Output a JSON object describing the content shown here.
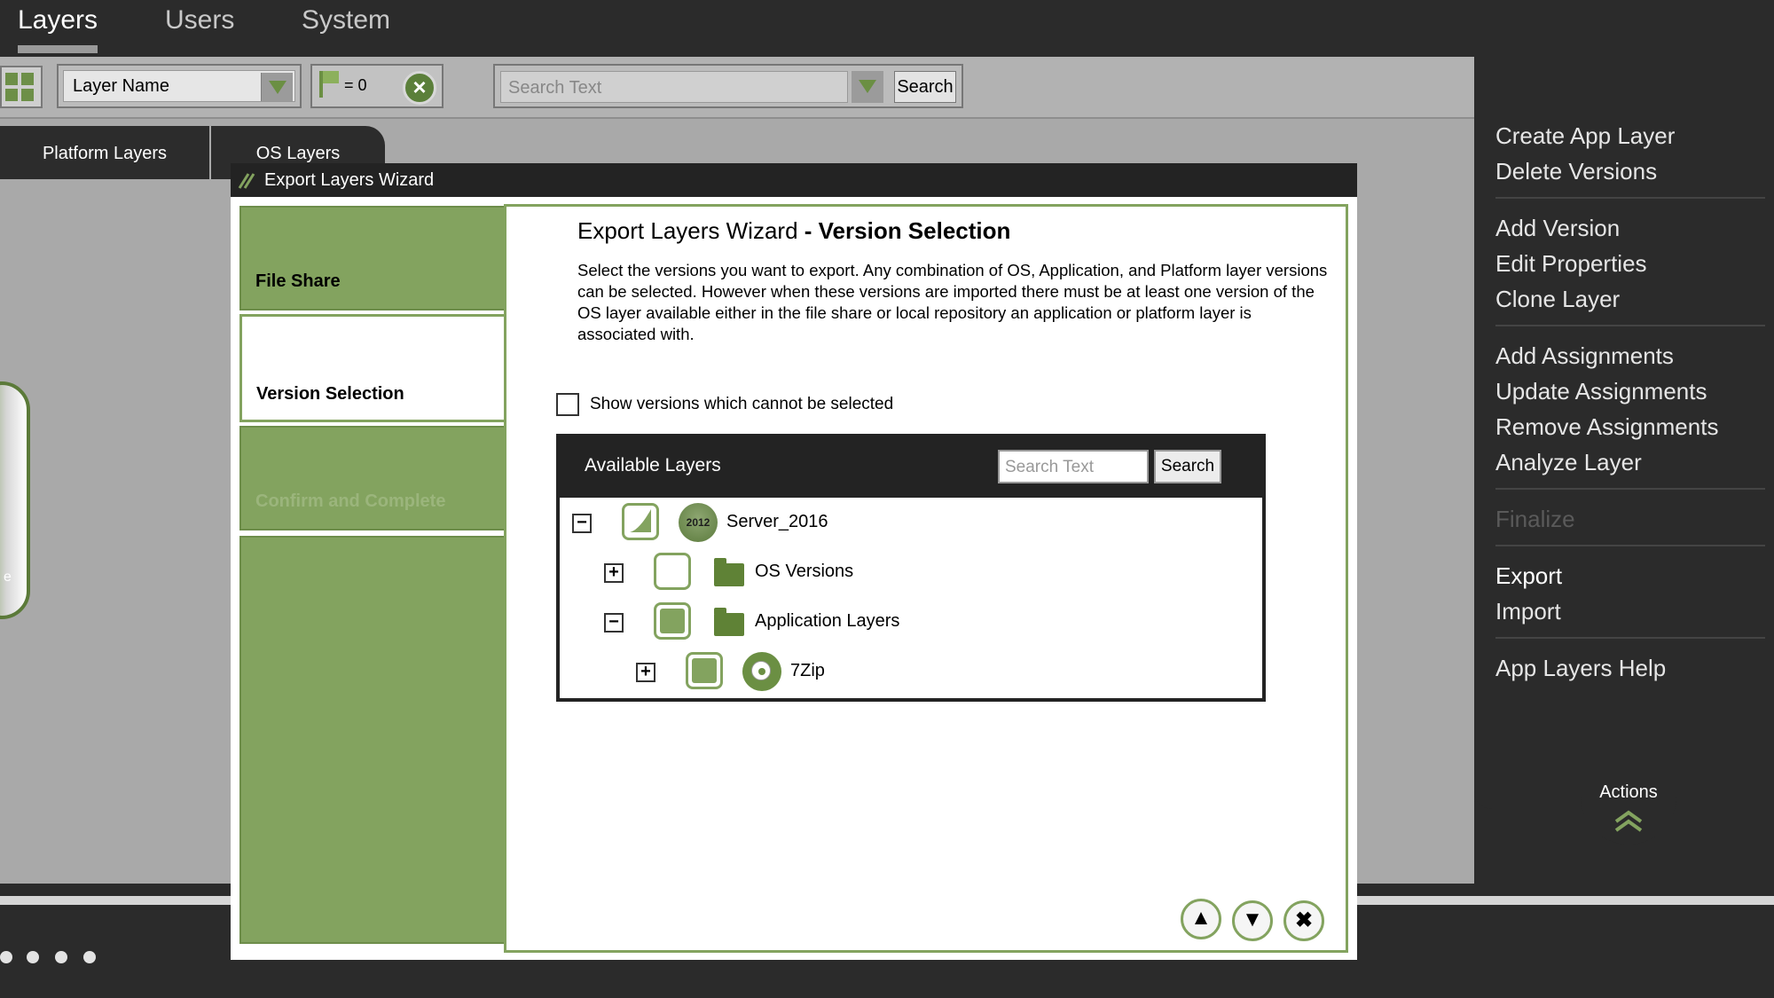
{
  "topnav": {
    "tabs": [
      "Layers",
      "Users",
      "System"
    ],
    "active": "Layers"
  },
  "toolbar": {
    "filter_select": "Layer Name",
    "flag_count": "= 0",
    "search_placeholder": "Search Text",
    "search_button": "Search"
  },
  "layer_tabs": [
    "Platform Layers",
    "OS Layers"
  ],
  "wizard": {
    "title": "Export Layers Wizard",
    "steps": [
      "File Share",
      "Version Selection",
      "Confirm and Complete"
    ],
    "current_step": "Version Selection",
    "heading_prefix": "Export Layers Wizard",
    "heading_suffix": "- Version Selection",
    "description": "Select the versions you want to export.  Any combination of OS, Application, and Platform layer versions can be selected.  However when these versions are imported there must be at least one version of the OS layer available either in the file share or local repository an application or platform layer is associated with.",
    "show_unselectable_label": "Show versions which cannot be selected",
    "available": {
      "title": "Available Layers",
      "search_placeholder": "Search Text",
      "search_button": "Search",
      "tree": [
        {
          "label": "Server_2016",
          "os_badge": "2012",
          "expand": "−"
        },
        {
          "label": "OS Versions",
          "expand": "+"
        },
        {
          "label": "Application Layers",
          "expand": "−"
        },
        {
          "label": "7Zip",
          "expand": "+"
        }
      ]
    }
  },
  "actions": {
    "items": [
      "Create App Layer",
      "Delete Versions",
      "Add Version",
      "Edit Properties",
      "Clone Layer",
      "Add Assignments",
      "Update Assignments",
      "Remove Assignments",
      "Analyze Layer",
      "Finalize",
      "Export",
      "Import",
      "App Layers Help"
    ],
    "handle_label": "Actions"
  },
  "colors": {
    "accent": "#83a35f",
    "dark": "#2b2b2b",
    "workspace": "#a9a9a9"
  }
}
